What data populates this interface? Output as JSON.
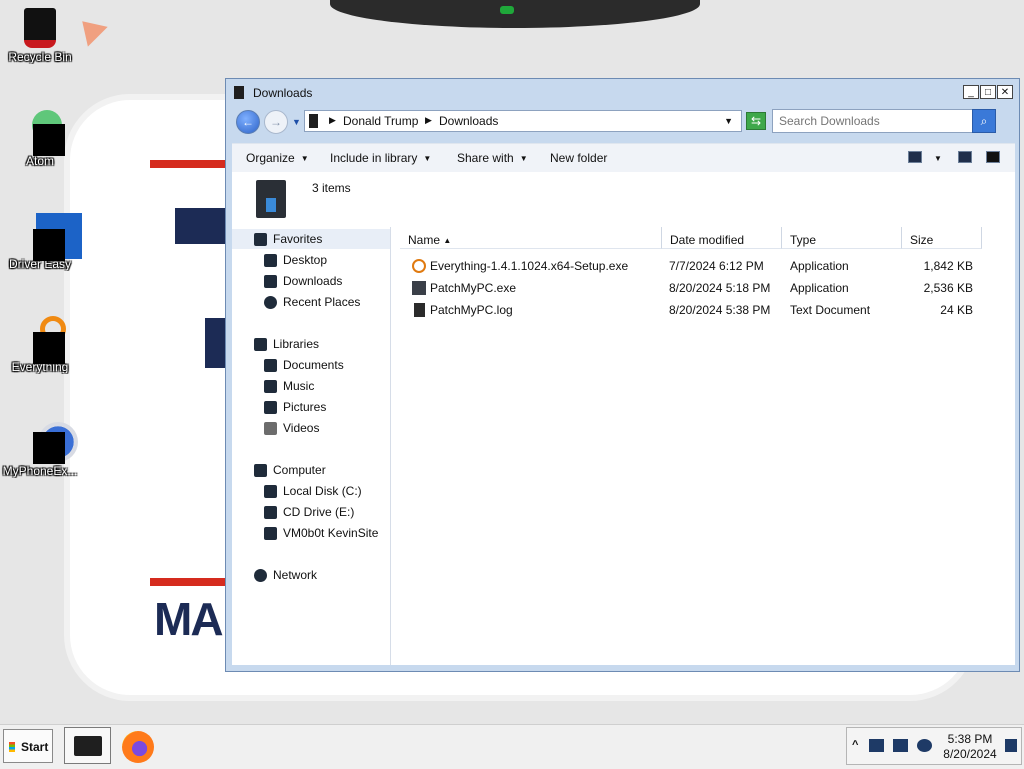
{
  "desktop": {
    "icons": [
      {
        "label": "Recycle Bin"
      },
      {
        "label": "Atom"
      },
      {
        "label": "Driver Easy"
      },
      {
        "label": "Everything"
      },
      {
        "label": "MyPhoneEx..."
      }
    ],
    "wallpaper_text": "MA"
  },
  "window": {
    "title": "Downloads",
    "buttons": {
      "minimize": "_",
      "maximize": "□",
      "close": "✕"
    },
    "address": {
      "crumbs": [
        "Donald Trump",
        "Downloads"
      ]
    },
    "search": {
      "placeholder": "Search Downloads"
    },
    "toolbar": {
      "organize": "Organize",
      "include_in_library": "Include in library",
      "share_with": "Share with",
      "new_folder": "New folder"
    },
    "items_count": "3 items",
    "nav": {
      "favorites": {
        "label": "Favorites",
        "items": [
          "Desktop",
          "Downloads",
          "Recent Places"
        ]
      },
      "libraries": {
        "label": "Libraries",
        "items": [
          "Documents",
          "Music",
          "Pictures",
          "Videos"
        ]
      },
      "computer": {
        "label": "Computer",
        "items": [
          "Local Disk (C:)",
          "CD Drive (E:)",
          "VM0b0t KevinSite"
        ]
      },
      "network": {
        "label": "Network"
      }
    },
    "columns": {
      "name": "Name",
      "date_modified": "Date modified",
      "type": "Type",
      "size": "Size"
    },
    "files": [
      {
        "name": "Everything-1.4.1.1024.x64-Setup.exe",
        "date": "7/7/2024 6:12 PM",
        "type": "Application",
        "size": "1,842 KB",
        "icon": "key-icon"
      },
      {
        "name": "PatchMyPC.exe",
        "date": "8/20/2024 5:18 PM",
        "type": "Application",
        "size": "2,536 KB",
        "icon": "app-icon"
      },
      {
        "name": "PatchMyPC.log",
        "date": "8/20/2024 5:38 PM",
        "type": "Text Document",
        "size": "24 KB",
        "icon": "log-file-icon"
      }
    ]
  },
  "taskbar": {
    "start_label": "Start",
    "clock": {
      "time": "5:38 PM",
      "date": "8/20/2024"
    }
  }
}
